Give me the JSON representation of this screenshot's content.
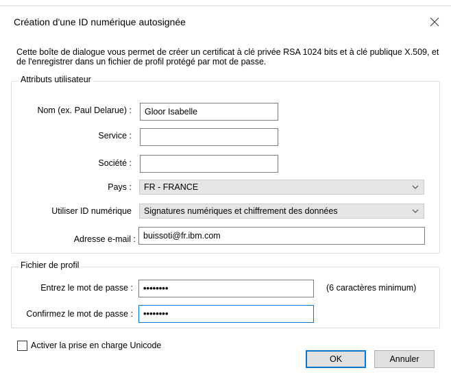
{
  "dialog": {
    "title": "Création d'une ID numérique autosignée",
    "description": "Cette boîte de dialogue vous permet de créer un certificat à clé privée RSA 1024 bits et à clé publique X.509, et de l'enregistrer dans un fichier de profil protégé par mot de passe."
  },
  "user_attributes": {
    "legend": "Attributs utilisateur",
    "name_label": "Nom (ex. Paul Delarue) :",
    "name_value": "Gloor Isabelle",
    "service_label": "Service :",
    "service_value": "",
    "company_label": "Société :",
    "company_value": "",
    "country_label": "Pays :",
    "country_value": "FR - FRANCE",
    "use_label": "Utiliser ID numérique",
    "use_value": "Signatures numériques et chiffrement des données",
    "email_label": "Adresse e-mail :",
    "email_value": "buissoti@fr.ibm.com"
  },
  "profile_file": {
    "legend": "Fichier de profil",
    "password_label": "Entrez le mot de passe :",
    "password_value": "••••••••",
    "password_hint": "(6 caractères minimum)",
    "confirm_label": "Confirmez le mot de passe :",
    "confirm_value": "••••••••"
  },
  "unicode_checkbox": {
    "label": "Activer la prise en charge Unicode",
    "checked": false
  },
  "buttons": {
    "ok": "OK",
    "cancel": "Annuler"
  },
  "icons": {
    "close": "close-icon",
    "dropdown": "chevron-down-icon"
  },
  "colors": {
    "focus_accent": "#0078d7",
    "select_background": "#e5e5e5"
  }
}
